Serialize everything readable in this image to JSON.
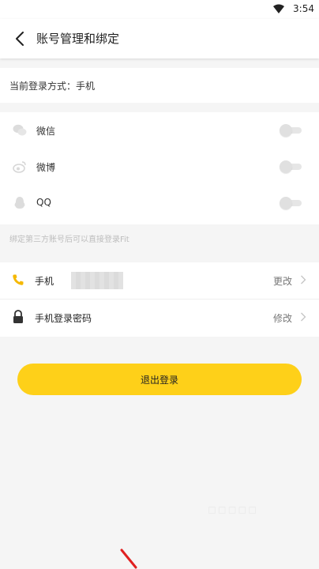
{
  "status_bar": {
    "time": "3:54",
    "wifi_icon": "wifi-icon"
  },
  "header": {
    "title": "账号管理和绑定",
    "back_icon": "back-arrow-icon"
  },
  "login_mode": {
    "text": "当前登录方式：手机"
  },
  "bindings": {
    "items": [
      {
        "label": "微信",
        "icon": "wechat-icon",
        "enabled": false
      },
      {
        "label": "微博",
        "icon": "weibo-icon",
        "enabled": false
      },
      {
        "label": "QQ",
        "icon": "qq-icon",
        "enabled": false
      }
    ],
    "hint": "绑定第三方账号后可以直接登录Fit"
  },
  "account": {
    "phone": {
      "label": "手机",
      "action": "更改",
      "icon": "phone-icon"
    },
    "password": {
      "label": "手机登录密码",
      "action": "修改",
      "icon": "lock-icon"
    }
  },
  "logout_label": "退出登录",
  "colors": {
    "accent": "#fed019",
    "phone_icon": "#f5b800",
    "background": "#f5f5f5"
  }
}
